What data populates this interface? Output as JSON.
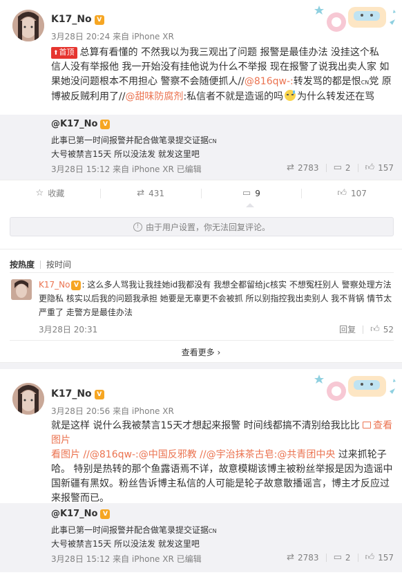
{
  "post1": {
    "author": "K17_No",
    "meta": "3月28日 20:24 来自 iPhone XR",
    "top_tag": "首顶",
    "body_lines": [
      "总算有看懂的 不然我以为我三观出了问题  报警是最佳办法 没挂这个私",
      "信人没有举报他  我一开始没有挂他说为什么不举报  现在报警了说我出卖人家  如",
      "果她没问题根本不用担心  警察不会随便抓人//",
      "博被反贼利用了//",
      "私信者不就是造谣的吗",
      "为什么转发还在骂"
    ],
    "mention_1": "@816qw-:",
    "text_after_mention_1": "转发骂的都是恨",
    "cn_small": "CN",
    "text_after_cn": "党  原",
    "mention_2": "@甜味防腐剂",
    "repost": {
      "author": "@K17_No",
      "line1": "此事已第一时间报警并配合做笔录提交证据",
      "line1_cn": "CN",
      "line2": "大号被禁言15天 所以没法发 就发这里吧",
      "meta": "3月28日 15:12 来自 iPhone XR  已编辑",
      "reposts": "2783",
      "comments": "2",
      "likes": "157"
    },
    "actions": {
      "favorite": "收藏",
      "repost": "431",
      "comment": "9",
      "like": "107"
    },
    "notice": "由于用户设置，你无法回复评论。",
    "sort": {
      "hot": "按热度",
      "time": "按时间"
    },
    "comment": {
      "author": "K17_No",
      "text_line1": ": 这么多人骂我让我挂她id我都没有 我想全都留给jc核实 不想冤枉别人 警察处理方法",
      "text_line2": "更隐私 核实以后我的问题我承担 她要是无辜更不会被抓 所以别指控我出卖别人 我不背锅 情节太",
      "text_line3": "严重了 走警方是最佳办法",
      "meta": "3月28日 20:31",
      "reply": "回复",
      "likes": "52"
    },
    "see_more": "查看更多"
  },
  "post2": {
    "author": "K17_No",
    "meta": "3月28日 20:56 来自 iPhone XR",
    "body_line1": "就是这样 说什么我被禁言15天才想起来报警 时间线都搞不清别给我比比",
    "view_image": "查看图片",
    "body_line2_pre": "看图片 //",
    "mention_a": "@816qw-:",
    "mention_b": "@中国反邪教",
    "mention_c": "@宇治抹茶古皂:",
    "mention_d": "@共青团中央",
    "body_line2_post": "过来抓轮子",
    "body_line3": "哈。 特别是热转的那个鱼露语焉不详，故意模糊该博主被粉丝举报是因为造谣中",
    "body_line4": "国新疆有黑奴。粉丝告诉博主私信的人可能是轮子故意散播谣言，博主才反应过",
    "body_line5": "来报警而已。",
    "repost": {
      "author": "@K17_No",
      "line1": "此事已第一时间报警并配合做笔录提交证据",
      "line1_cn": "CN",
      "line2": "大号被禁言15天 所以没法发 就发这里吧",
      "meta": "3月28日 15:12 来自 iPhone XR  已编辑",
      "reposts": "2783",
      "comments": "2",
      "likes": "157"
    }
  },
  "colors": {
    "link": "#eb7350",
    "top_tag": "#e6352f",
    "gray_bg": "#f2f2f5"
  },
  "icons": [
    "star-icon",
    "repost-icon",
    "comment-icon",
    "like-icon",
    "lock-icon",
    "vip-icon",
    "chevron-right-icon",
    "sweat-emoji-icon"
  ]
}
